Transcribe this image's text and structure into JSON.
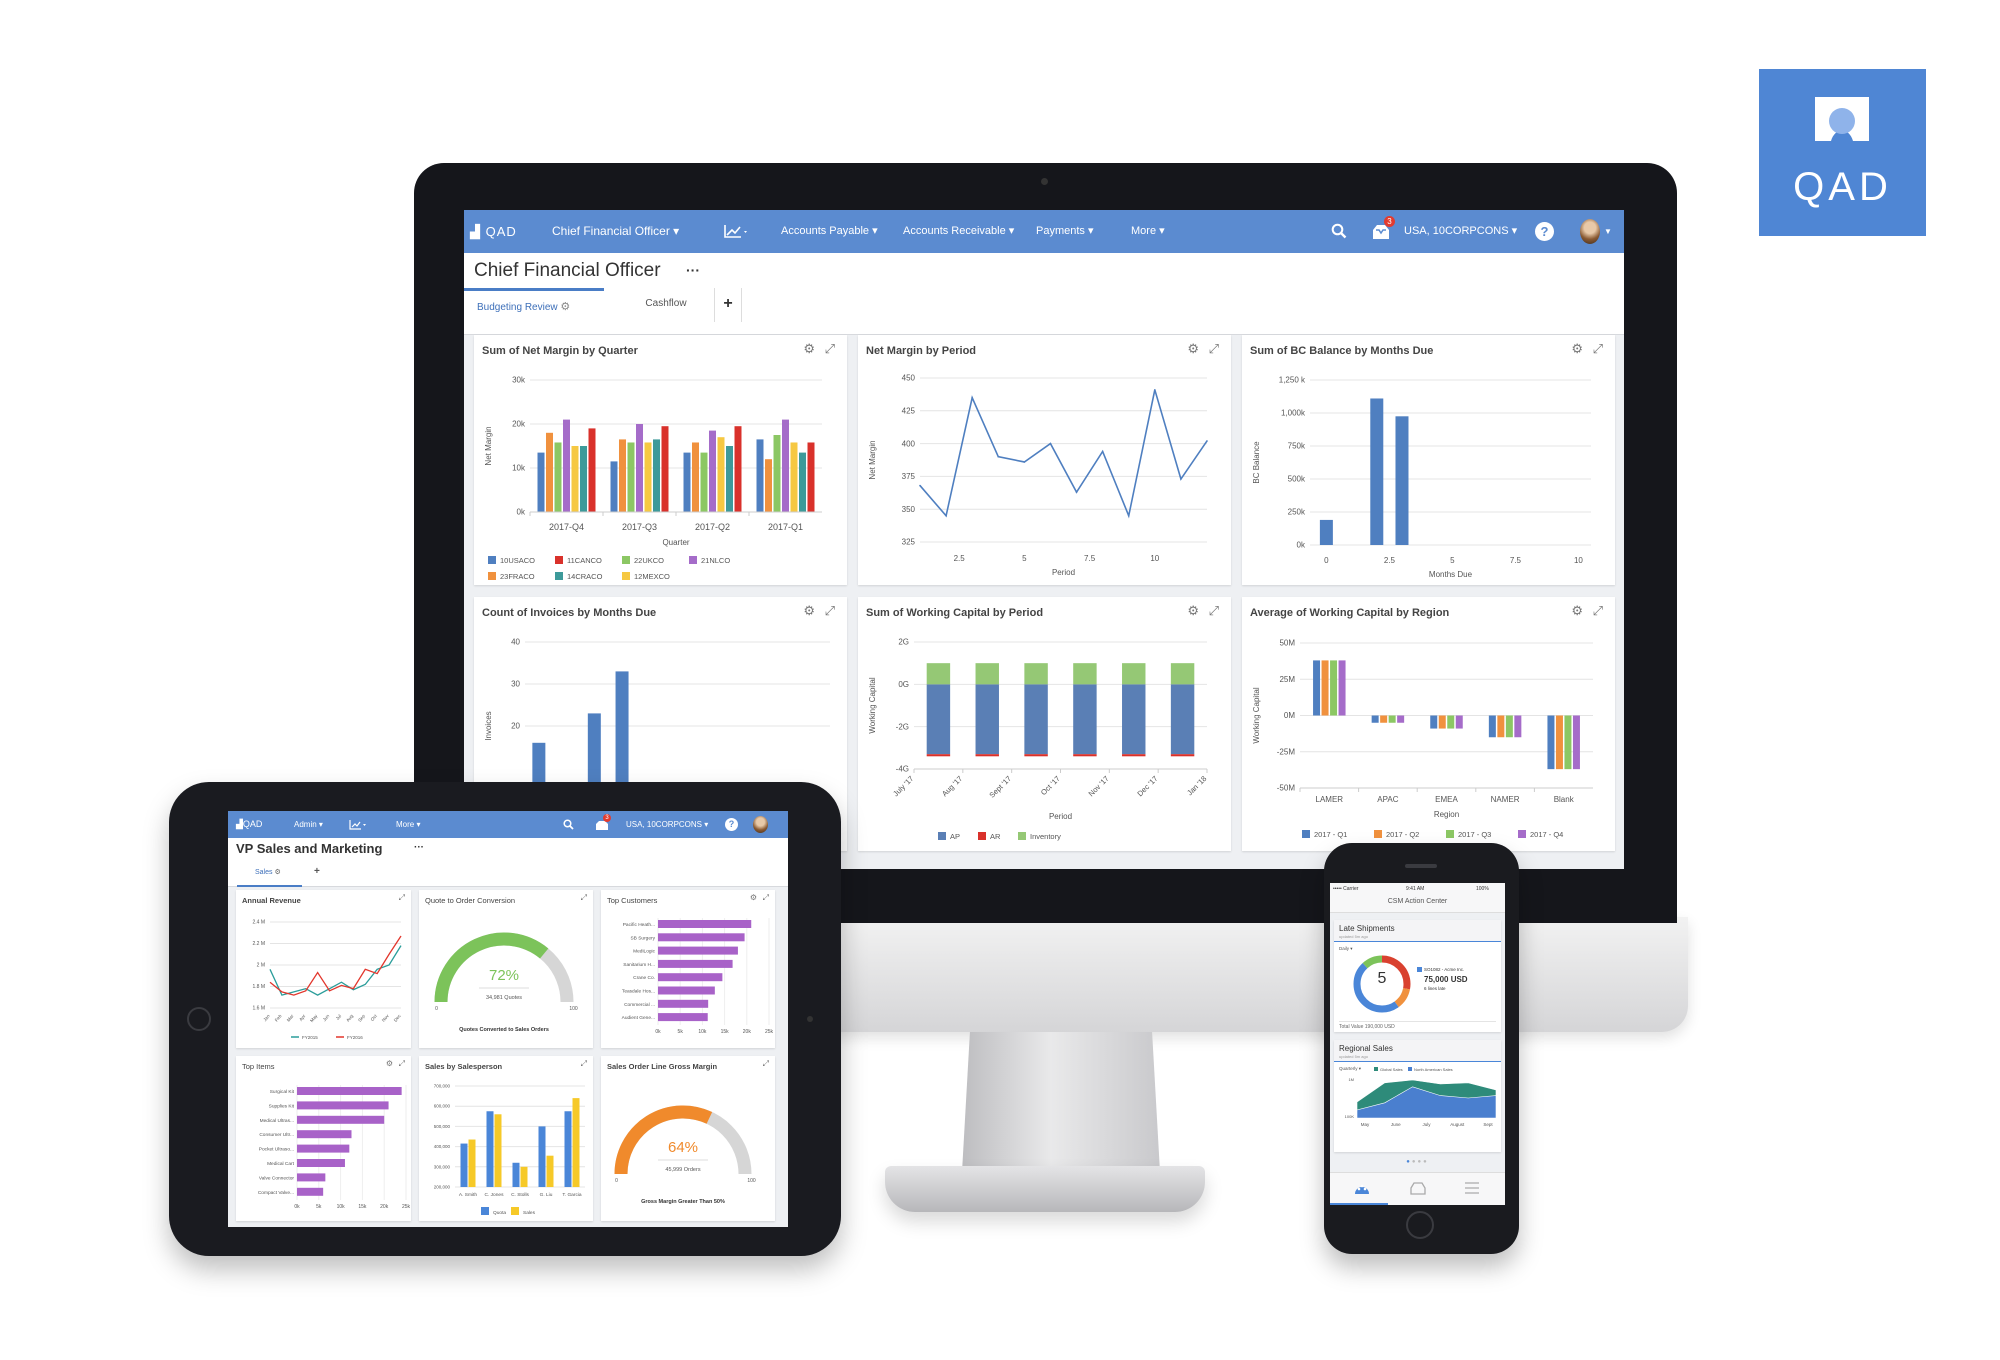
{
  "logo": {
    "text": "QAD",
    "color": "#4f86d4"
  },
  "monitor": {
    "nav": {
      "brand": "QAD",
      "role": "Chief Financial Officer ▾",
      "items": [
        "Accounts Payable ▾",
        "Accounts Receivable ▾",
        "Payments ▾",
        "More ▾"
      ],
      "company": "USA, 10CORPCONS ▾",
      "badge": "3",
      "color": "#5b8bd0"
    },
    "title": "Chief Financial Officer",
    "title_menu": "···",
    "tabs": [
      {
        "label": "Budgeting Review",
        "active": true
      },
      {
        "label": "Cashflow"
      }
    ],
    "add_tab": "+"
  },
  "tablet": {
    "nav": {
      "brand": "QAD",
      "role": "Admin ▾",
      "more": "More ▾",
      "company": "USA, 10CORPCONS ▾",
      "badge": "3"
    },
    "title": "VP Sales and Marketing",
    "title_menu": "···",
    "tabs": [
      {
        "label": "Sales",
        "active": true
      }
    ],
    "add_tab": "+"
  },
  "phone": {
    "status": {
      "carrier": "••••• Carrier",
      "time": "9:41 AM",
      "battery": "100%"
    },
    "title": "CSM Action Center",
    "late_shipments": {
      "title": "Late Shipments",
      "updated": "updated 5m ago",
      "filter": "Daily ▾",
      "count": "5",
      "order": "SO1082 - Acme Inc.",
      "amount": "75,000 USD",
      "lines": "6 lines late",
      "total": "Total Value 190,000 USD"
    },
    "regional_sales": {
      "title": "Regional Sales",
      "updated": "updated 5m ago",
      "filter": "Quarterly ▾"
    }
  },
  "chart_data": [
    {
      "type": "bar",
      "title": "Sum of Net Margin by Quarter",
      "xlabel": "Quarter",
      "ylabel": "Net Margin",
      "categories": [
        "2017-Q4",
        "2017-Q3",
        "2017-Q2",
        "2017-Q1"
      ],
      "ylim": [
        0,
        30000
      ],
      "yticks": [
        0,
        10000,
        20000,
        30000
      ],
      "ytick_labels": [
        "0k",
        "10k",
        "20k",
        "30k"
      ],
      "series": [
        {
          "name": "10USACO",
          "color": "#4f7fc0",
          "values": [
            13500,
            11500,
            13500,
            16500
          ]
        },
        {
          "name": "23FRACO",
          "color": "#f0913e",
          "values": [
            18000,
            16500,
            15800,
            12000
          ]
        },
        {
          "name": "22UKCO",
          "color": "#8cc764",
          "values": [
            15800,
            15800,
            13500,
            17500
          ]
        },
        {
          "name": "21NLCO",
          "color": "#a56cc9",
          "values": [
            21000,
            20000,
            18500,
            21000
          ]
        },
        {
          "name": "12MEXCO",
          "color": "#f6c842",
          "values": [
            15000,
            15800,
            17000,
            15800
          ]
        },
        {
          "name": "14CRACO",
          "color": "#3d9a9a",
          "values": [
            15000,
            16500,
            15000,
            13500
          ]
        },
        {
          "name": "11CANCO",
          "color": "#d9312b",
          "values": [
            19000,
            19500,
            19500,
            15800
          ]
        }
      ],
      "legend": [
        "10USACO",
        "11CANCO",
        "22UKCO",
        "21NLCO",
        "23FRACO",
        "14CRACO",
        "12MEXCO"
      ],
      "legend_position": "bottom",
      "grid": true
    },
    {
      "type": "line",
      "title": "Net Margin by Period",
      "xlabel": "Period",
      "ylabel": "Net Margin",
      "x": [
        1,
        2,
        3,
        4,
        5,
        6,
        7,
        8,
        9,
        10,
        11,
        12
      ],
      "y": [
        368,
        345,
        435,
        390,
        386,
        400,
        363,
        394,
        345,
        441,
        373,
        402
      ],
      "xlim": [
        1,
        12
      ],
      "ylim": [
        325,
        450
      ],
      "xticks": [
        2.5,
        5,
        7.5,
        10
      ],
      "xtick_labels": [
        "2.5",
        "5",
        "7.5",
        "10"
      ],
      "yticks": [
        325,
        350,
        375,
        400,
        425,
        450
      ],
      "ytick_labels": [
        "325",
        "350",
        "375",
        "400",
        "425",
        "450"
      ],
      "color": "#4f7fc0",
      "grid": true
    },
    {
      "type": "bar",
      "title": "Sum of BC Balance by Months Due",
      "xlabel": "Months Due",
      "ylabel": "BC Balance",
      "x": [
        0,
        2,
        3
      ],
      "values": [
        190000,
        1110000,
        975000
      ],
      "ylim": [
        0,
        1250000
      ],
      "yticks": [
        0,
        250000,
        500000,
        750000,
        1000000,
        1250000
      ],
      "ytick_labels": [
        "0k",
        "250k",
        "500k",
        "750k",
        "1,000k",
        "1,250 k"
      ],
      "xticks": [
        0,
        2.5,
        5,
        7.5,
        10
      ],
      "xtick_labels": [
        "0",
        "2.5",
        "5",
        "7.5",
        "10"
      ],
      "color": "#4f7fc0",
      "grid": true
    },
    {
      "type": "bar",
      "title": "Count of Invoices by Months Due",
      "ylabel": "Invoices",
      "x": [
        0,
        2,
        3
      ],
      "values": [
        16,
        23,
        33
      ],
      "ylim": [
        0,
        40
      ],
      "yticks": [
        20,
        30,
        40
      ],
      "ytick_labels": [
        "20",
        "30",
        "40"
      ],
      "color": "#4f7fc0",
      "grid": true
    },
    {
      "type": "bar",
      "stacked": true,
      "title": "Sum of Working Capital by Period",
      "xlabel": "Period",
      "ylabel": "Working Capital",
      "categories": [
        "July '17",
        "Aug '17",
        "Sept '17",
        "Oct '17",
        "Nov '17",
        "Dec '17"
      ],
      "xtick_labels": [
        "July '17",
        "Aug '17",
        "Sept '17",
        "Oct '17",
        "Nov '17",
        "Dec '17",
        "Jan '18"
      ],
      "ylim": [
        -4000000000,
        2000000000
      ],
      "yticks": [
        -4000000000,
        -2000000000,
        0,
        2000000000
      ],
      "ytick_labels": [
        "-4G",
        "-2G",
        "0G",
        "2G"
      ],
      "series": [
        {
          "name": "AP",
          "color": "#5a7fb5",
          "values": [
            -3300000000,
            -3300000000,
            -3300000000,
            -3300000000,
            -3300000000,
            -3300000000
          ]
        },
        {
          "name": "AR",
          "color": "#d9312b",
          "values": [
            -100000000,
            -100000000,
            -100000000,
            -100000000,
            -100000000,
            -100000000
          ]
        },
        {
          "name": "Inventory",
          "color": "#95c875",
          "values": [
            1000000000,
            1000000000,
            1000000000,
            1000000000,
            1000000000,
            1000000000
          ]
        }
      ],
      "legend_position": "bottom",
      "grid": true
    },
    {
      "type": "bar",
      "title": "Average of Working Capital by Region",
      "xlabel": "Region",
      "ylabel": "Working Capital",
      "categories": [
        "LAMER",
        "APAC",
        "EMEA",
        "NAMER",
        "Blank"
      ],
      "ylim": [
        -50000000,
        50000000
      ],
      "yticks": [
        -50000000,
        -25000000,
        0,
        25000000,
        50000000
      ],
      "ytick_labels": [
        "-50M",
        "-25M",
        "0M",
        "25M",
        "50M"
      ],
      "series": [
        {
          "name": "2017 - Q1",
          "color": "#4f7fc0",
          "values": [
            38000000,
            -5000000,
            -9000000,
            -15000000,
            -37000000
          ]
        },
        {
          "name": "2017 - Q2",
          "color": "#f0913e",
          "values": [
            38000000,
            -5000000,
            -9000000,
            -15000000,
            -37000000
          ]
        },
        {
          "name": "2017 - Q3",
          "color": "#8cc764",
          "values": [
            38000000,
            -5000000,
            -9000000,
            -15000000,
            -37000000
          ]
        },
        {
          "name": "2017 - Q4",
          "color": "#a56cc9",
          "values": [
            38000000,
            -5000000,
            -9000000,
            -15000000,
            -37000000
          ]
        }
      ],
      "legend_position": "bottom",
      "grid": true
    },
    {
      "type": "line",
      "title": "Annual Revenue",
      "categories": [
        "Jan",
        "Feb",
        "Mar",
        "Apr",
        "May",
        "Jun",
        "Jul",
        "Aug",
        "Sep",
        "Oct",
        "Nov",
        "Dec"
      ],
      "ylim": [
        1600000,
        2400000
      ],
      "yticks": [
        1600000,
        1800000,
        2000000,
        2200000,
        2400000
      ],
      "ytick_labels": [
        "1.6 M",
        "1.8 M",
        "2 M",
        "2.2 M",
        "2.4 M"
      ],
      "series": [
        {
          "name": "FY2015",
          "color": "#2a9d9a",
          "values": [
            1960000,
            1720000,
            1750000,
            1780000,
            1720000,
            1780000,
            1840000,
            1770000,
            1820000,
            1960000,
            2000000,
            2180000
          ]
        },
        {
          "name": "FY2016",
          "color": "#e2362c",
          "values": [
            1840000,
            1750000,
            1720000,
            1760000,
            1930000,
            1760000,
            1810000,
            1780000,
            1960000,
            1920000,
            2100000,
            2270000
          ]
        }
      ],
      "legend_position": "bottom",
      "grid": true
    },
    {
      "type": "gauge",
      "title": "Quote to Order Conversion",
      "value": 72,
      "value_label": "72%",
      "sub_label": "34,981 Quotes",
      "min_label": "0",
      "max_label": "100",
      "footer": "Quotes Converted to Sales Orders",
      "color": "#7cc35a"
    },
    {
      "type": "bar",
      "orientation": "horizontal",
      "title": "Top Customers",
      "categories": [
        "Pacific Heath...",
        "SB Surgery",
        "MediLogic",
        "Sanitarium H...",
        "Crane Co.",
        "Teasdale Hos...",
        "Commercial ...",
        "Audient Gene..."
      ],
      "values": [
        21000,
        19500,
        18000,
        16800,
        14500,
        12800,
        11300,
        11200
      ],
      "xlim": [
        0,
        25000
      ],
      "xticks": [
        0,
        5000,
        10000,
        15000,
        20000,
        25000
      ],
      "xtick_labels": [
        "0k",
        "5k",
        "10k",
        "15k",
        "20k",
        "25k"
      ],
      "color": "#a862c8"
    },
    {
      "type": "bar",
      "orientation": "horizontal",
      "title": "Top Items",
      "categories": [
        "Surgical Kit",
        "Supplies Kit",
        "Medical Ultras...",
        "Consumer Ultr...",
        "Pocket Ultraso...",
        "Medical Cart",
        "Valve Connector",
        "Compact Valve..."
      ],
      "values": [
        24000,
        21000,
        20000,
        12500,
        12000,
        11000,
        6500,
        6000
      ],
      "xlim": [
        0,
        25000
      ],
      "xticks": [
        0,
        5000,
        10000,
        15000,
        20000,
        25000
      ],
      "xtick_labels": [
        "0k",
        "5k",
        "10k",
        "15k",
        "20k",
        "25k"
      ],
      "color": "#a862c8"
    },
    {
      "type": "bar",
      "title": "Sales by Salesperson",
      "categories": [
        "A. Smith",
        "C. Jones",
        "C. Stolls",
        "G. Liu",
        "T. Garcia"
      ],
      "ylim": [
        200000,
        700000
      ],
      "yticks": [
        200000,
        300000,
        400000,
        500000,
        600000,
        700000
      ],
      "ytick_labels": [
        "200,000",
        "300,000",
        "400,000",
        "500,000",
        "600,000",
        "700,000"
      ],
      "series": [
        {
          "name": "Quota",
          "color": "#4a86d8",
          "values": [
            415000,
            575000,
            320000,
            500000,
            575000
          ]
        },
        {
          "name": "Sales",
          "color": "#f6c928",
          "values": [
            435000,
            560000,
            300000,
            355000,
            640000
          ]
        }
      ],
      "legend_position": "bottom",
      "grid": true
    },
    {
      "type": "gauge",
      "title": "Sales Order Line Gross Margin",
      "value": 64,
      "value_label": "64%",
      "sub_label": "45,999 Orders",
      "min_label": "0",
      "max_label": "100",
      "footer": "Gross Margin Greater Than 50%",
      "color": "#f08a2c"
    },
    {
      "type": "pie",
      "donut": true,
      "title": "Late Shipments",
      "slices": [
        {
          "color": "#d9412f",
          "value": 28
        },
        {
          "color": "#f0913e",
          "value": 12
        },
        {
          "color": "#4a86d8",
          "value": 48
        },
        {
          "color": "#7cc35a",
          "value": 12
        }
      ]
    },
    {
      "type": "area",
      "title": "Regional Sales",
      "categories": [
        "May",
        "June",
        "July",
        "August",
        "Sept"
      ],
      "ytick_labels": [
        "100K",
        "1M"
      ],
      "series": [
        {
          "name": "Global Sales",
          "color": "#2e8b7a",
          "values": [
            0.4,
            0.88,
            0.95,
            0.85,
            0.88,
            0.7
          ]
        },
        {
          "name": "North American Sales",
          "color": "#4a7fcf",
          "values": [
            0.2,
            0.38,
            0.78,
            0.56,
            0.5,
            0.56
          ]
        }
      ],
      "legend_position": "top"
    }
  ]
}
